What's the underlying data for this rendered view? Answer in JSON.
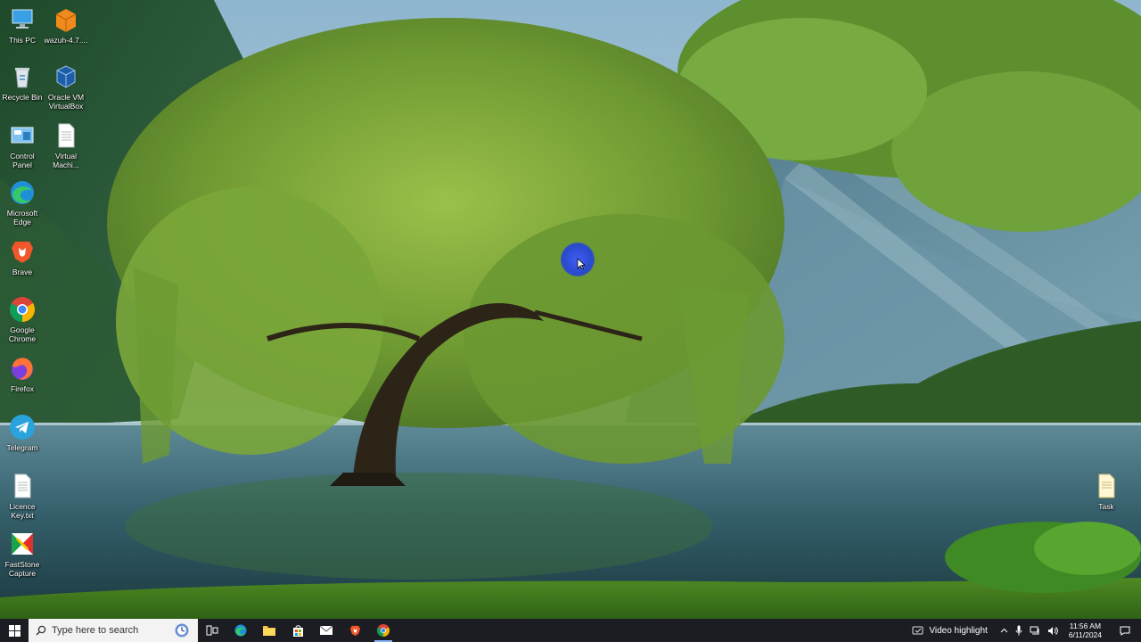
{
  "desktop": {
    "icons_left_col1": [
      {
        "id": "this-pc",
        "label": "This PC"
      },
      {
        "id": "recycle-bin",
        "label": "Recycle Bin"
      },
      {
        "id": "control-panel",
        "label": "Control Panel"
      },
      {
        "id": "edge",
        "label": "Microsoft Edge"
      },
      {
        "id": "brave",
        "label": "Brave"
      },
      {
        "id": "chrome",
        "label": "Google Chrome"
      },
      {
        "id": "firefox",
        "label": "Firefox"
      },
      {
        "id": "telegram",
        "label": "Telegram"
      },
      {
        "id": "licence",
        "label": "Licence Key.txt"
      },
      {
        "id": "faststone",
        "label": "FastStone Capture"
      }
    ],
    "icons_left_col2": [
      {
        "id": "wazuh",
        "label": "wazuh-4.7...."
      },
      {
        "id": "virtualbox",
        "label": "Oracle VM VirtualBox"
      },
      {
        "id": "virtual-machine",
        "label": "Virtual Machi..."
      }
    ],
    "icon_right": {
      "id": "task",
      "label": "Task"
    }
  },
  "taskbar": {
    "search_placeholder": "Type here to search",
    "video_highlight": "Video highlight",
    "time": "11:56 AM",
    "date": "6/11/2024"
  },
  "colors": {
    "taskbar_bg": "#1b1d22",
    "accent": "#8ab4f8",
    "cursor_halo": "#2a48e8"
  }
}
